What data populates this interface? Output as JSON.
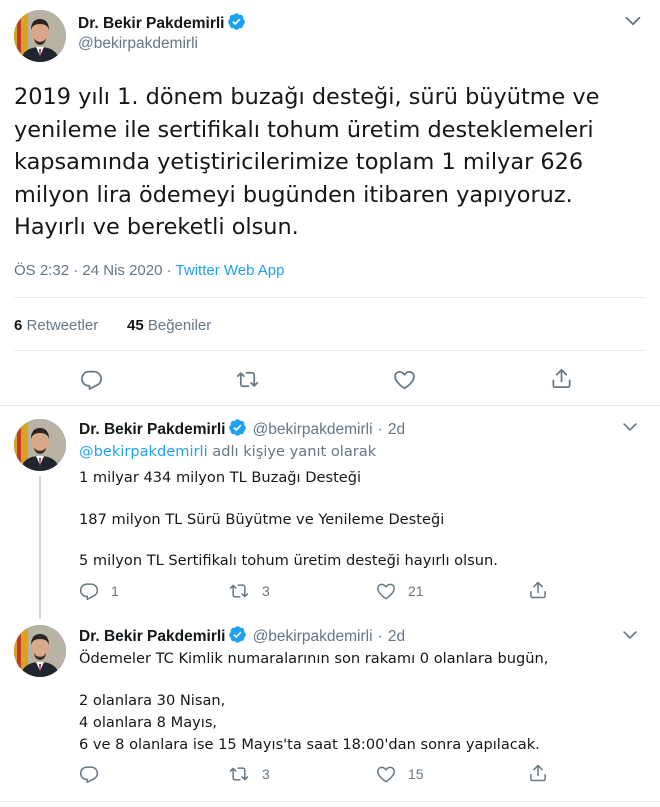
{
  "main_tweet": {
    "author_name": "Dr. Bekir Pakdemirli",
    "author_handle": "@bekirpakdemirli",
    "lines": [
      "2019 yılı 1. dönem buzağı desteği, sürü büyütme ve",
      "yenileme ile sertifikalı tohum üretim desteklemeleri",
      "kapsamında yetiştiricilerimize toplam 1 milyar 626",
      "milyon lira ödemeyi bugünden itibaren yapıyoruz.",
      "Hayırlı ve bereketli olsun."
    ],
    "time": "ÖS 2:32",
    "date": "24 Nis 2020",
    "separator": "·",
    "source": "Twitter Web App",
    "retweets_count": "6",
    "retweets_label": "Retweetler",
    "likes_count": "45",
    "likes_label": "Beğeniler"
  },
  "replies": [
    {
      "author_name": "Dr. Bekir Pakdemirli",
      "author_handle": "@bekirpakdemirli",
      "separator": "·",
      "age": "2d",
      "reply_to_mention": "@bekirpakdemirli",
      "reply_to_suffix": "adlı kişiye yanıt olarak",
      "lines": [
        "1 milyar 434 milyon TL Buzağı Desteği",
        "187 milyon TL Sürü Büyütme ve Yenileme Desteği",
        "5 milyon TL Sertifikalı tohum üretim desteği hayırlı olsun."
      ],
      "reply_count": "1",
      "retweet_count": "3",
      "like_count": "21"
    },
    {
      "author_name": "Dr. Bekir Pakdemirli",
      "author_handle": "@bekirpakdemirli",
      "separator": "·",
      "age": "2d",
      "lines": [
        "Ödemeler TC Kimlik numaralarının son rakamı 0 olanlara bugün,",
        "2 olanlara 30 Nisan,",
        "4 olanlara 8 Mayıs,",
        "6 ve 8 olanlara ise 15 Mayıs'ta saat 18:00'dan sonra yapılacak."
      ],
      "retweet_count": "3",
      "like_count": "15"
    }
  ],
  "colors": {
    "accent": "#1da1f2",
    "secondary_text": "#657786",
    "primary_text": "#14171a",
    "divider": "#e6ecf0"
  },
  "icons": [
    "verified-badge-icon",
    "chevron-down-icon",
    "reply-icon",
    "retweet-icon",
    "like-icon",
    "share-icon"
  ]
}
